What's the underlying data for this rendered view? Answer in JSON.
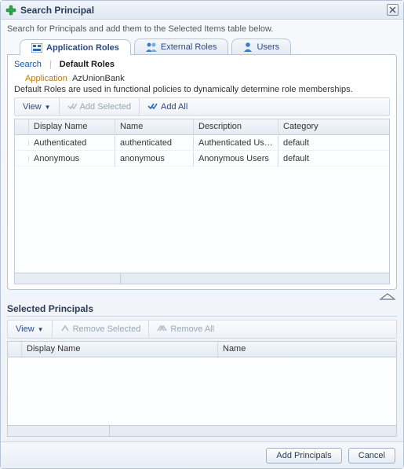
{
  "title": "Search Principal",
  "instruction": "Search for Principals and add them to the Selected Items table below.",
  "tabs": [
    {
      "label": "Application Roles",
      "icon": "app-roles"
    },
    {
      "label": "External Roles",
      "icon": "ext-roles"
    },
    {
      "label": "Users",
      "icon": "users"
    }
  ],
  "subtabs": {
    "search": "Search",
    "default_roles": "Default Roles"
  },
  "application": {
    "label": "Application",
    "value": "AzUnionBank"
  },
  "description": "Default Roles are used in functional policies to dynamically determine role memberships.",
  "toolbar": {
    "view": "View",
    "add_selected": "Add Selected",
    "add_all": "Add All"
  },
  "upper_table": {
    "headers": {
      "display_name": "Display Name",
      "name": "Name",
      "description": "Description",
      "category": "Category"
    },
    "rows": [
      {
        "display_name": "Authenticated",
        "name": "authenticated",
        "description": "Authenticated Users",
        "category": "default"
      },
      {
        "display_name": "Anonymous",
        "name": "anonymous",
        "description": "Anonymous Users",
        "category": "default"
      }
    ]
  },
  "selected_section": {
    "title": "Selected Principals",
    "toolbar": {
      "view": "View",
      "remove_selected": "Remove Selected",
      "remove_all": "Remove All"
    },
    "headers": {
      "display_name": "Display Name",
      "name": "Name"
    }
  },
  "footer": {
    "add": "Add Principals",
    "cancel": "Cancel"
  }
}
